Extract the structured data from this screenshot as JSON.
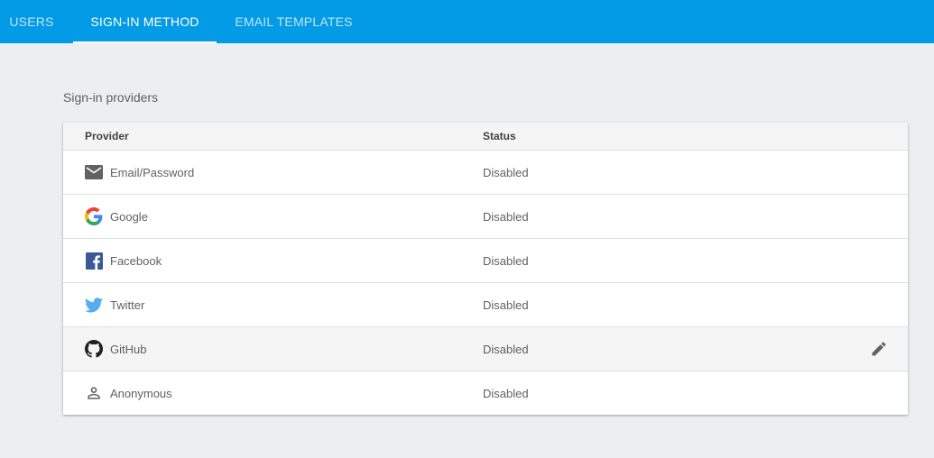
{
  "tabs": [
    {
      "label": "USERS",
      "active": false
    },
    {
      "label": "SIGN-IN METHOD",
      "active": true
    },
    {
      "label": "EMAIL TEMPLATES",
      "active": false
    }
  ],
  "section_title": "Sign-in providers",
  "table": {
    "headers": {
      "provider": "Provider",
      "status": "Status"
    },
    "rows": [
      {
        "icon": "email-icon",
        "name": "Email/Password",
        "status": "Disabled"
      },
      {
        "icon": "google-icon",
        "name": "Google",
        "status": "Disabled"
      },
      {
        "icon": "facebook-icon",
        "name": "Facebook",
        "status": "Disabled"
      },
      {
        "icon": "twitter-icon",
        "name": "Twitter",
        "status": "Disabled"
      },
      {
        "icon": "github-icon",
        "name": "GitHub",
        "status": "Disabled",
        "hovered": true,
        "edit_icon": "pencil-icon"
      },
      {
        "icon": "person-icon",
        "name": "Anonymous",
        "status": "Disabled"
      }
    ]
  },
  "colors": {
    "tabbar": "#039be5",
    "background": "#eceff1",
    "facebook": "#3b5998",
    "twitter": "#55acee"
  }
}
